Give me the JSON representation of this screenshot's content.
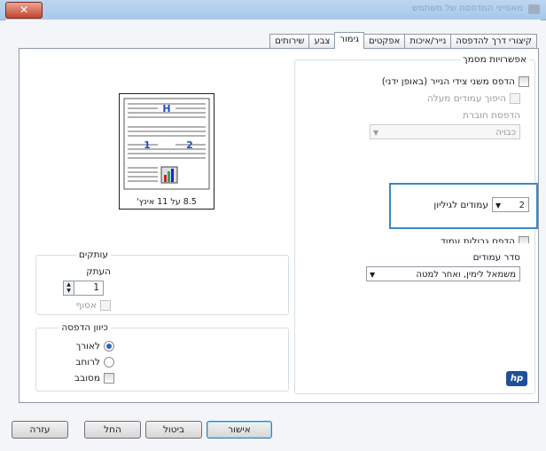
{
  "window": {
    "title": "מאפייני המדפסת של משתמש",
    "close_glyph": "✕"
  },
  "tabs": [
    {
      "label": "קיצורי דרך להדפסה"
    },
    {
      "label": "נייר/איכות"
    },
    {
      "label": "אפקטים"
    },
    {
      "label": "גימור"
    },
    {
      "label": "צבע"
    },
    {
      "label": "שירותים"
    }
  ],
  "active_tab": "גימור",
  "doc_options": {
    "title": "אפשרויות מסמך",
    "print_both_sides": "הדפס משני צידי הנייר (באופן ידני)",
    "flip_pages_up": "היפוך עמודים מעלה",
    "booklet_label": "הדפסת חוברת",
    "booklet_value": "כבויה",
    "pages_per_sheet_value": "2",
    "pages_per_sheet_label": "עמודים לגיליון",
    "print_page_borders": "הדפס גבולות עמוד",
    "page_order_label": "סדר עמודים",
    "page_order_value": "משמאל לימין, ואחר למטה"
  },
  "preview": {
    "size_label": "8.5 על 11 אינץ'",
    "page_letters": [
      "H",
      "1",
      "2"
    ]
  },
  "copies": {
    "title": "עותקים",
    "copies_label": "העתק",
    "copies_value": "1",
    "collate_label": "אסוף"
  },
  "orientation": {
    "title": "כיוון הדפסה",
    "portrait": "לאורך",
    "landscape": "לרוחב",
    "rotate": "מסובב"
  },
  "logo": {
    "text": "hp"
  },
  "buttons": {
    "ok": "אישור",
    "cancel": "ביטול",
    "apply": "החל",
    "help": "עזרה"
  }
}
